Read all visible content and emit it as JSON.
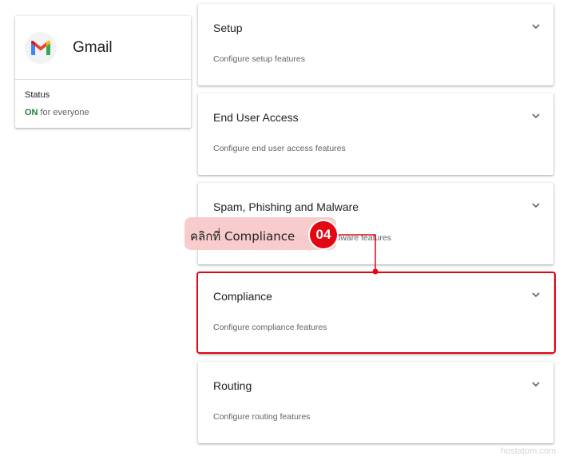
{
  "app": {
    "name": "Gmail",
    "logo_icon": "gmail-logo-icon",
    "status_label": "Status",
    "status_value": "ON",
    "status_suffix": "for everyone",
    "status_color": "#188038"
  },
  "sections": [
    {
      "title": "Setup",
      "description": "Configure setup features"
    },
    {
      "title": "End User Access",
      "description": "Configure end user access features"
    },
    {
      "title": "Spam, Phishing and Malware",
      "description": "Configure spam, phishing and malware features"
    },
    {
      "title": "Compliance",
      "description": "Configure compliance features"
    },
    {
      "title": "Routing",
      "description": "Configure routing features"
    }
  ],
  "annotation": {
    "callout_text": "คลิกที่ Compliance",
    "step_number": "04",
    "accent_color": "#e30613",
    "target_section": "Compliance"
  },
  "watermark": "hostatom.com"
}
